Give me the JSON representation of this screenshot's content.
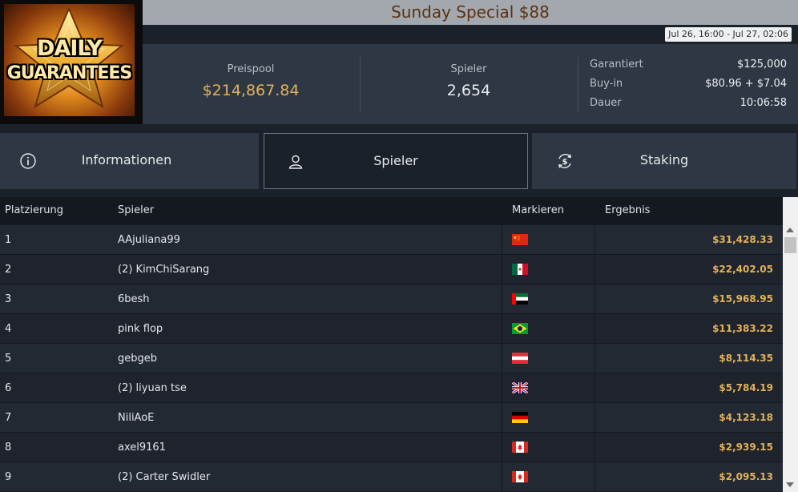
{
  "logo": {
    "line1": "DAILY",
    "line2": "GUARANTEES"
  },
  "header": {
    "title": "Sunday Special $88",
    "date_range": "Jul 26, 16:00 - Jul 27, 02:06"
  },
  "stats": {
    "prize_pool_label": "Preispool",
    "prize_pool_value": "$214,867.84",
    "players_label": "Spieler",
    "players_value": "2,654",
    "info": [
      {
        "key": "Garantiert",
        "value": "$125,000"
      },
      {
        "key": "Buy-in",
        "value": "$80.96 + $7.04"
      },
      {
        "key": "Dauer",
        "value": "10:06:58"
      }
    ]
  },
  "tabs": [
    {
      "label": "Informationen",
      "icon": "info-icon",
      "active": false
    },
    {
      "label": "Spieler",
      "icon": "user-icon",
      "active": true
    },
    {
      "label": "Staking",
      "icon": "dollar-refresh-icon",
      "active": false
    }
  ],
  "table": {
    "columns": [
      "Platzierung",
      "Spieler",
      "Markieren",
      "Ergebnis"
    ],
    "rows": [
      {
        "place": "1",
        "player": "AAjuliana99",
        "flag": "china-flag",
        "result": "$31,428.33"
      },
      {
        "place": "2",
        "player": "(2) KimChiSarang",
        "flag": "mexico-flag",
        "result": "$22,402.05"
      },
      {
        "place": "3",
        "player": "6besh",
        "flag": "uae-flag",
        "result": "$15,968.95"
      },
      {
        "place": "4",
        "player": "pink flop",
        "flag": "brazil-flag",
        "result": "$11,383.22"
      },
      {
        "place": "5",
        "player": "gebgeb",
        "flag": "austria-flag",
        "result": "$8,114.35"
      },
      {
        "place": "6",
        "player": "(2) liyuan tse",
        "flag": "uk-flag",
        "result": "$5,784.19"
      },
      {
        "place": "7",
        "player": "NiliAoE",
        "flag": "germany-flag",
        "result": "$4,123.18"
      },
      {
        "place": "8",
        "player": "axel9161",
        "flag": "canada-flag",
        "result": "$2,939.15"
      },
      {
        "place": "9",
        "player": "(2) Carter Swidler",
        "flag": "canada-flag",
        "result": "$2,095.13"
      }
    ]
  },
  "colors": {
    "accent_gold": "#e3b15a",
    "title_brown": "#5a3212",
    "panel": "#2e3845"
  }
}
